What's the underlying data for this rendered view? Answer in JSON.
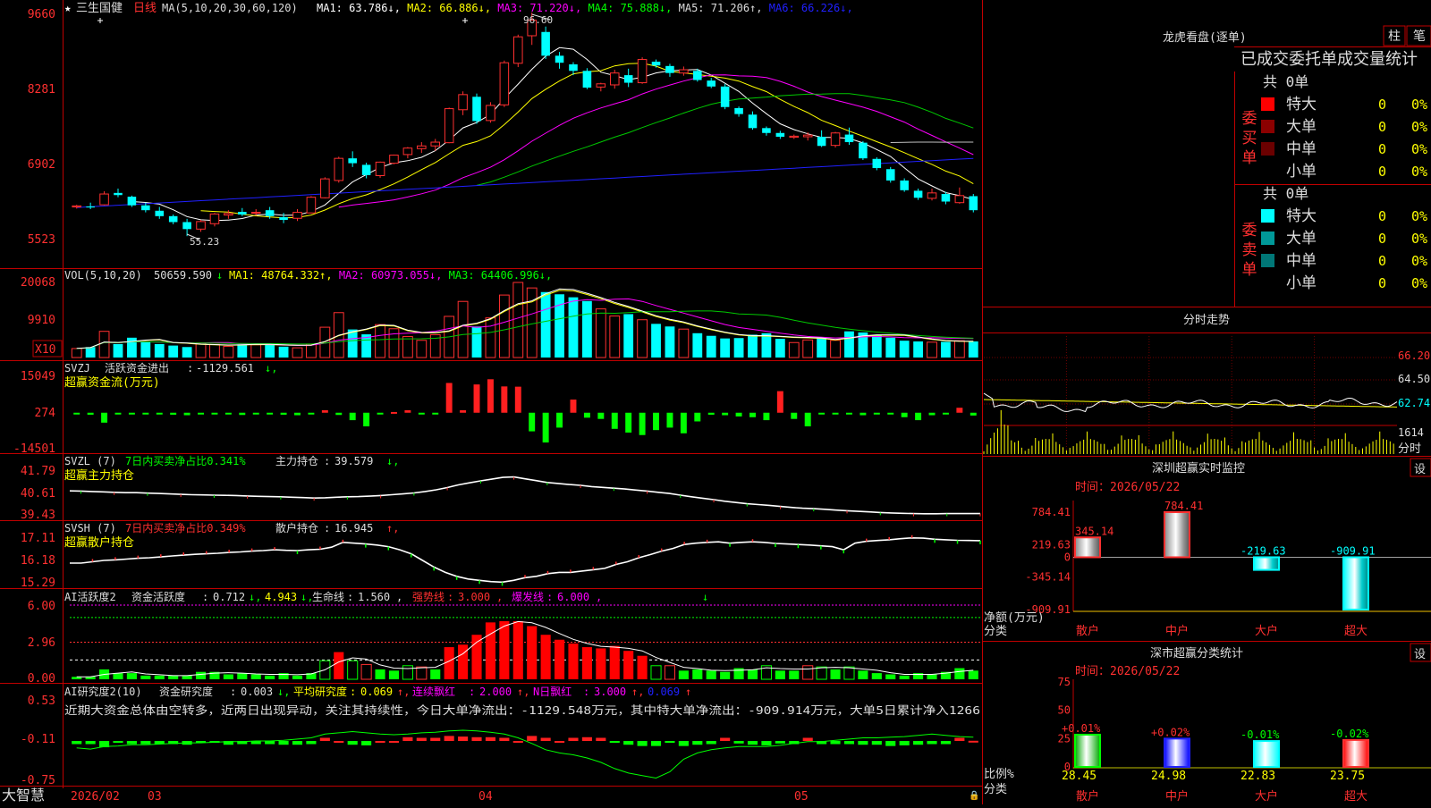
{
  "stock": {
    "name": "三生国健",
    "period": "日线",
    "ma_params": "MA(5,10,20,30,60,120)",
    "ma_values": [
      {
        "name": "MA1",
        "value": "63.786",
        "arrow": "↓",
        "color": "#ffffff"
      },
      {
        "name": "MA2",
        "value": "66.886",
        "arrow": "↓",
        "color": "#ffff00"
      },
      {
        "name": "MA3",
        "value": "71.220",
        "arrow": "↓",
        "color": "#ff00ff"
      },
      {
        "name": "MA4",
        "value": "75.888",
        "arrow": "↓",
        "color": "#00ff00"
      },
      {
        "name": "MA5",
        "value": "71.206",
        "arrow": "↑",
        "color": "#c0c0c0"
      },
      {
        "name": "MA6",
        "value": "66.226",
        "arrow": "↓",
        "color": "#2020ff"
      }
    ],
    "price_axis": [
      "9660",
      "8281",
      "6902",
      "5523"
    ],
    "high_label": "96.60",
    "low_label": "55.23"
  },
  "vol": {
    "params": "VOL(5,10,20)",
    "value": "50659.590",
    "ma": [
      {
        "name": "MA1",
        "value": "48764.332",
        "arrow": "↑",
        "color": "#ffff00"
      },
      {
        "name": "MA2",
        "value": "60973.055",
        "arrow": "↓",
        "color": "#ff00ff"
      },
      {
        "name": "MA3",
        "value": "64406.996",
        "arrow": "↓",
        "color": "#00ff00"
      }
    ],
    "axis": [
      "20068",
      "9910"
    ],
    "unit": "X10"
  },
  "svzj": {
    "name": "SVZJ",
    "label": "活跃资金进出",
    "value": "-1129.561",
    "subtitle": "超赢资金流(万元)",
    "axis": [
      "15049",
      "274",
      "-14501"
    ]
  },
  "svzl": {
    "name": "SVZL (7)",
    "label1": "7日内买卖净占比0.341%",
    "label2": "主力持仓",
    "value": "39.579",
    "subtitle": "超赢主力持仓",
    "axis": [
      "41.79",
      "40.61",
      "39.43"
    ]
  },
  "svsh": {
    "name": "SVSH (7)",
    "label1": "7日内买卖净占比0.349%",
    "label2": "散户持仓",
    "value": "16.945",
    "subtitle": "超赢散户持仓",
    "axis": [
      "17.11",
      "16.18",
      "15.29"
    ]
  },
  "ai_active": {
    "name": "AI活跃度2",
    "label": "资金活跃度",
    "value1": "0.712",
    "value2": "4.943",
    "life_label": "生命线",
    "life_value": "1.560",
    "strong_label": "强势线",
    "strong_value": "3.000",
    "burst_label": "爆发线",
    "burst_value": "6.000",
    "axis": [
      "6.00",
      "2.96",
      "0.00"
    ]
  },
  "ai_research": {
    "name": "AI研究度2(10)",
    "label": "资金研究度",
    "value": "0.003",
    "avg_label": "平均研究度",
    "avg_value": "0.069",
    "cont_label": "连续飘红",
    "cont_value": "2.000",
    "n_label": "N日飘红",
    "n_value": "3.000",
    "last_value": "0.069",
    "comment": "近期大资金总体由空转多，近两日出现异动，关注其持续性，今日大单净流出：-1129.548万元，其中特大单净流出：-909.914万元，大单5日累计净入1266",
    "axis": [
      "0.53",
      "-0.11",
      "-0.75"
    ]
  },
  "xaxis": {
    "labels": [
      "2026/02",
      "03",
      "04",
      "05"
    ]
  },
  "brand": "大智慧",
  "longhu": {
    "title": "龙虎看盘(逐单)",
    "btn1": "柱",
    "btn2": "笔",
    "subtitle": "已成交委托单成交量统计",
    "buy": {
      "side_label": "委买单",
      "total": "共 0单",
      "rows": [
        {
          "label": "特大",
          "value": "0",
          "pct": "0%",
          "color": "#ff0000"
        },
        {
          "label": "大单",
          "value": "0",
          "pct": "0%",
          "color": "#8b0000"
        },
        {
          "label": "中单",
          "value": "0",
          "pct": "0%",
          "color": "#6b0000"
        },
        {
          "label": "小单",
          "value": "0",
          "pct": "0%",
          "color": ""
        }
      ]
    },
    "sell": {
      "side_label": "委卖单",
      "total": "共 0单",
      "rows": [
        {
          "label": "特大",
          "value": "0",
          "pct": "0%",
          "color": "#00ffff"
        },
        {
          "label": "大单",
          "value": "0",
          "pct": "0%",
          "color": "#009999"
        },
        {
          "label": "中单",
          "value": "0",
          "pct": "0%",
          "color": "#007777"
        },
        {
          "label": "小单",
          "value": "0",
          "pct": "0%",
          "color": ""
        }
      ]
    }
  },
  "intraday": {
    "title": "分时走势",
    "axis": [
      "66.20",
      "64.50",
      "62.74",
      "1614"
    ],
    "unit": "分时"
  },
  "sz_monitor": {
    "title": "深圳超赢实时监控",
    "btn": "设",
    "date_label": "时间：2026/05/22",
    "axis": [
      "784.41",
      "219.63",
      "0",
      "-345.14",
      "-909.91"
    ],
    "ylabel": "净额(万元)",
    "xlabel": "分类",
    "categories": [
      "散户",
      "中户",
      "大户",
      "超大"
    ],
    "values_label": [
      "345.14",
      "784.41",
      "-219.63",
      "-909.91"
    ]
  },
  "sz_classify": {
    "title": "深市超赢分类统计",
    "btn": "设",
    "date_label": "时间：2026/05/22",
    "axis": [
      "75",
      "50",
      "25",
      "0"
    ],
    "ylabel": "比例%",
    "xlabel": "分类",
    "categories": [
      "散户",
      "中户",
      "大户",
      "超大"
    ],
    "change_labels": [
      "+0.01%",
      "+0.02%",
      "-0.01%",
      "-0.02%"
    ],
    "value_labels": [
      "28.45",
      "24.98",
      "22.83",
      "23.75"
    ]
  },
  "chart_data": [
    {
      "type": "candlestick",
      "title": "三生国健 日线",
      "ylim": [
        55.23,
        96.6
      ],
      "x_labels": [
        "2026/02",
        "03",
        "04",
        "05"
      ],
      "candles": [
        [
          60.6,
          61.0,
          60.3,
          60.8
        ],
        [
          60.7,
          61.4,
          60.2,
          60.5
        ],
        [
          61.0,
          63.5,
          60.9,
          63.0
        ],
        [
          63.2,
          64.0,
          62.4,
          62.8
        ],
        [
          62.5,
          62.7,
          60.6,
          60.9
        ],
        [
          60.9,
          61.4,
          59.6,
          60.0
        ],
        [
          59.9,
          60.6,
          58.4,
          58.9
        ],
        [
          58.9,
          59.2,
          57.4,
          57.8
        ],
        [
          57.8,
          58.4,
          55.2,
          56.5
        ],
        [
          56.5,
          58.2,
          56.0,
          57.9
        ],
        [
          57.5,
          59.5,
          57.0,
          59.3
        ],
        [
          59.1,
          60.0,
          58.4,
          59.4
        ],
        [
          59.7,
          60.4,
          58.9,
          59.2
        ],
        [
          59.5,
          60.2,
          59.0,
          59.6
        ],
        [
          60.0,
          60.6,
          58.4,
          58.9
        ],
        [
          58.7,
          59.5,
          57.6,
          58.2
        ],
        [
          58.5,
          60.2,
          58.0,
          59.6
        ],
        [
          59.5,
          62.6,
          59.4,
          62.4
        ],
        [
          62.3,
          66.1,
          62.2,
          65.8
        ],
        [
          65.5,
          69.9,
          65.1,
          69.6
        ],
        [
          69.6,
          70.9,
          68.0,
          68.7
        ],
        [
          68.4,
          68.8,
          65.9,
          66.5
        ],
        [
          66.4,
          69.0,
          66.0,
          68.9
        ],
        [
          68.7,
          70.3,
          68.5,
          70.2
        ],
        [
          70.3,
          71.7,
          69.6,
          71.5
        ],
        [
          71.4,
          72.6,
          70.6,
          71.9
        ],
        [
          71.9,
          73.2,
          71.0,
          72.6
        ],
        [
          72.5,
          79.0,
          72.4,
          78.8
        ],
        [
          78.6,
          82.0,
          77.6,
          81.4
        ],
        [
          81.0,
          81.6,
          76.0,
          76.5
        ],
        [
          76.6,
          80.0,
          76.2,
          79.4
        ],
        [
          79.5,
          87.7,
          79.1,
          87.3
        ],
        [
          87.2,
          92.5,
          86.5,
          92.1
        ],
        [
          92.3,
          96.6,
          90.6,
          95.2
        ],
        [
          93.0,
          94.0,
          88.0,
          88.6
        ],
        [
          88.6,
          89.3,
          86.2,
          87.3
        ],
        [
          87.0,
          87.4,
          85.0,
          85.8
        ],
        [
          85.8,
          86.3,
          82.4,
          82.7
        ],
        [
          82.8,
          83.6,
          82.0,
          83.4
        ],
        [
          83.2,
          86.0,
          82.5,
          85.4
        ],
        [
          85.0,
          86.2,
          82.8,
          83.6
        ],
        [
          83.6,
          88.3,
          83.4,
          87.9
        ],
        [
          87.5,
          87.9,
          86.4,
          86.8
        ],
        [
          86.7,
          87.1,
          84.7,
          85.4
        ],
        [
          85.4,
          86.6,
          84.9,
          86.0
        ],
        [
          85.8,
          86.2,
          83.8,
          84.1
        ],
        [
          84.0,
          84.5,
          82.6,
          82.9
        ],
        [
          82.9,
          83.4,
          78.7,
          79.1
        ],
        [
          78.9,
          79.2,
          77.3,
          77.8
        ],
        [
          77.7,
          78.3,
          74.9,
          75.2
        ],
        [
          75.2,
          75.5,
          73.8,
          74.3
        ],
        [
          74.3,
          74.7,
          73.2,
          73.6
        ],
        [
          73.5,
          74.0,
          73.2,
          73.7
        ],
        [
          73.6,
          74.4,
          72.9,
          73.9
        ],
        [
          73.6,
          74.8,
          71.7,
          71.9
        ],
        [
          72.0,
          74.5,
          71.6,
          74.3
        ],
        [
          74.0,
          75.3,
          72.1,
          72.6
        ],
        [
          72.5,
          72.8,
          69.3,
          69.6
        ],
        [
          69.5,
          69.8,
          67.4,
          67.8
        ],
        [
          67.6,
          68.0,
          65.1,
          65.5
        ],
        [
          65.5,
          65.9,
          63.4,
          63.7
        ],
        [
          63.6,
          64.0,
          61.9,
          62.3
        ],
        [
          62.2,
          64.0,
          61.8,
          63.2
        ],
        [
          63.0,
          63.4,
          61.1,
          61.6
        ],
        [
          61.4,
          64.2,
          61.2,
          62.7
        ],
        [
          62.6,
          63.0,
          59.6,
          60.0
        ]
      ]
    },
    {
      "type": "bar",
      "title": "VOL(5,10,20)",
      "ylim": [
        0,
        20068
      ],
      "values": [
        2400,
        2800,
        7000,
        3600,
        5300,
        4100,
        3600,
        3200,
        2800,
        3900,
        3500,
        3000,
        3500,
        3400,
        3800,
        2900,
        2600,
        3600,
        8100,
        12000,
        7500,
        6200,
        8800,
        7700,
        5600,
        4600,
        6100,
        11000,
        15000,
        8300,
        10600,
        16700,
        20068,
        18600,
        17500,
        16900,
        16100,
        15100,
        13000,
        11100,
        11600,
        10100,
        9000,
        8300,
        7600,
        6500,
        5800,
        5100,
        5200,
        6100,
        6500,
        5000,
        4000,
        4700,
        5400,
        4600,
        7000,
        6700,
        6100,
        5300,
        4500,
        4300,
        4100,
        4200,
        4500,
        4300
      ]
    },
    {
      "type": "bar",
      "title": "SVZJ 活跃资金进出",
      "ylim": [
        -14501,
        15049
      ],
      "values": [
        -500,
        -800,
        -4000,
        -500,
        -700,
        -300,
        -500,
        -800,
        -1000,
        -500,
        -400,
        -600,
        -900,
        -700,
        -400,
        -800,
        -1000,
        -300,
        1000,
        -900,
        -3000,
        -5500,
        -500,
        300,
        1000,
        -700,
        -500,
        12000,
        1000,
        11400,
        13500,
        10600,
        10500,
        -7500,
        -12000,
        -6000,
        5300,
        -2000,
        -2500,
        -6500,
        -8000,
        -9000,
        -7000,
        -6000,
        -8300,
        -3500,
        -800,
        -1000,
        -1500,
        -1800,
        -3000,
        8700,
        -2500,
        -5500,
        -700,
        -300,
        -700,
        -1000,
        -400,
        -700,
        -1800,
        -3000,
        -1000,
        -700,
        2000,
        -1129.561
      ]
    },
    {
      "type": "line",
      "title": "SVZL 主力持仓",
      "ylim": [
        39.43,
        41.79
      ],
      "values": [
        40.69,
        40.68,
        40.66,
        40.64,
        40.62,
        40.6,
        40.6,
        40.58,
        40.56,
        40.54,
        40.52,
        40.5,
        40.49,
        40.48,
        40.47,
        40.46,
        40.44,
        40.42,
        40.41,
        40.4,
        40.38,
        40.36,
        40.34,
        40.35,
        40.38,
        40.4,
        40.41,
        40.43,
        40.46,
        40.5,
        40.54,
        40.59,
        40.66,
        40.74,
        40.85,
        40.98,
        41.08,
        41.18,
        41.26,
        41.35,
        41.37,
        41.28,
        41.19,
        41.1,
        41.05,
        41.0,
        40.96,
        40.9,
        40.86,
        40.82,
        40.78,
        40.73,
        40.68,
        40.62,
        40.56,
        40.48,
        40.4,
        40.33,
        40.26,
        40.18,
        40.12,
        40.06,
        40.02,
        39.98,
        39.93,
        39.88,
        39.84,
        39.82,
        39.79,
        39.75,
        39.72,
        39.69,
        39.66,
        39.63,
        39.61,
        39.59,
        39.58,
        39.57,
        39.57,
        39.58,
        39.58,
        39.58,
        39.579
      ]
    },
    {
      "type": "line",
      "title": "SVSH 散户持仓",
      "ylim": [
        15.29,
        17.11
      ],
      "values": [
        16.1,
        16.1,
        16.15,
        16.2,
        16.22,
        16.25,
        16.28,
        16.3,
        16.33,
        16.37,
        16.4,
        16.43,
        16.45,
        16.47,
        16.5,
        16.52,
        16.55,
        16.57,
        16.6,
        16.58,
        16.57,
        16.6,
        16.62,
        16.7,
        16.88,
        16.85,
        16.82,
        16.78,
        16.72,
        16.6,
        16.45,
        16.2,
        15.95,
        15.75,
        15.6,
        15.5,
        15.45,
        15.4,
        15.38,
        15.45,
        15.55,
        15.6,
        15.7,
        15.75,
        15.75,
        15.8,
        15.85,
        15.9,
        16.05,
        16.15,
        16.3,
        16.42,
        16.55,
        16.65,
        16.8,
        16.85,
        16.88,
        16.9,
        16.85,
        16.88,
        16.9,
        16.88,
        16.84,
        16.82,
        16.8,
        16.78,
        16.75,
        16.72,
        16.6,
        16.85,
        16.92,
        16.95,
        16.98,
        17.02,
        17.05,
        17.04,
        17.0,
        16.98,
        16.96,
        16.95,
        16.945
      ]
    },
    {
      "type": "bar",
      "title": "AI活跃度2 资金活跃度",
      "ylim": [
        0,
        6.0
      ],
      "values": [
        0.2,
        0.2,
        0.8,
        0.5,
        0.5,
        0.3,
        0.3,
        0.3,
        0.3,
        0.6,
        0.6,
        0.4,
        0.5,
        0.4,
        0.3,
        0.5,
        0.3,
        0.5,
        1.5,
        2.2,
        1.5,
        1.2,
        0.8,
        0.7,
        1.1,
        1.0,
        0.8,
        2.6,
        2.8,
        3.6,
        4.6,
        4.7,
        4.7,
        4.3,
        3.6,
        3.2,
        2.9,
        2.6,
        2.5,
        2.7,
        2.3,
        1.9,
        1.1,
        1.1,
        0.7,
        0.8,
        0.7,
        0.6,
        0.9,
        0.8,
        1.1,
        0.7,
        0.7,
        1.1,
        1.0,
        0.8,
        1.0,
        0.7,
        0.5,
        0.4,
        0.3,
        0.5,
        0.4,
        0.6,
        0.9,
        0.7
      ],
      "life_line": 1.56,
      "strong_line": 3.0,
      "burst_line": 6.0
    },
    {
      "type": "bar",
      "title": "AI研究度2(10)",
      "ylim": [
        -0.75,
        0.53
      ],
      "values": [
        -0.05,
        -0.05,
        -0.1,
        -0.03,
        -0.05,
        -0.05,
        -0.05,
        -0.05,
        -0.06,
        -0.03,
        -0.03,
        -0.06,
        -0.05,
        -0.05,
        -0.05,
        -0.06,
        -0.06,
        -0.05,
        0.05,
        0.0,
        -0.06,
        -0.07,
        0.0,
        0.0,
        0.06,
        0.05,
        0.05,
        0.08,
        0.07,
        0.06,
        0.06,
        0.05,
        0.0,
        0.08,
        0.05,
        0.0,
        0.05,
        0.06,
        0.05,
        -0.03,
        -0.06,
        -0.08,
        -0.08,
        -0.03,
        -0.08,
        -0.06,
        -0.05,
        0.05,
        -0.04,
        -0.06,
        -0.07,
        -0.04,
        -0.05,
        0.05,
        -0.05,
        -0.05,
        -0.05,
        -0.06,
        -0.06,
        -0.08,
        -0.07,
        -0.06,
        -0.05,
        -0.05,
        0.05,
        0.003
      ]
    },
    {
      "type": "bar",
      "title": "深圳超赢实时监控",
      "categories": [
        "散户",
        "中户",
        "大户",
        "超大"
      ],
      "values": [
        345.14,
        784.41,
        -219.63,
        -909.91
      ],
      "ylim": [
        -909.91,
        784.41
      ]
    },
    {
      "type": "bar",
      "title": "深市超赢分类统计",
      "categories": [
        "散户",
        "中户",
        "大户",
        "超大"
      ],
      "values": [
        28.45,
        24.98,
        22.83,
        23.75
      ],
      "changes": [
        "+0.01%",
        "+0.02%",
        "-0.01%",
        "-0.02%"
      ],
      "ylim": [
        0,
        75
      ]
    }
  ]
}
